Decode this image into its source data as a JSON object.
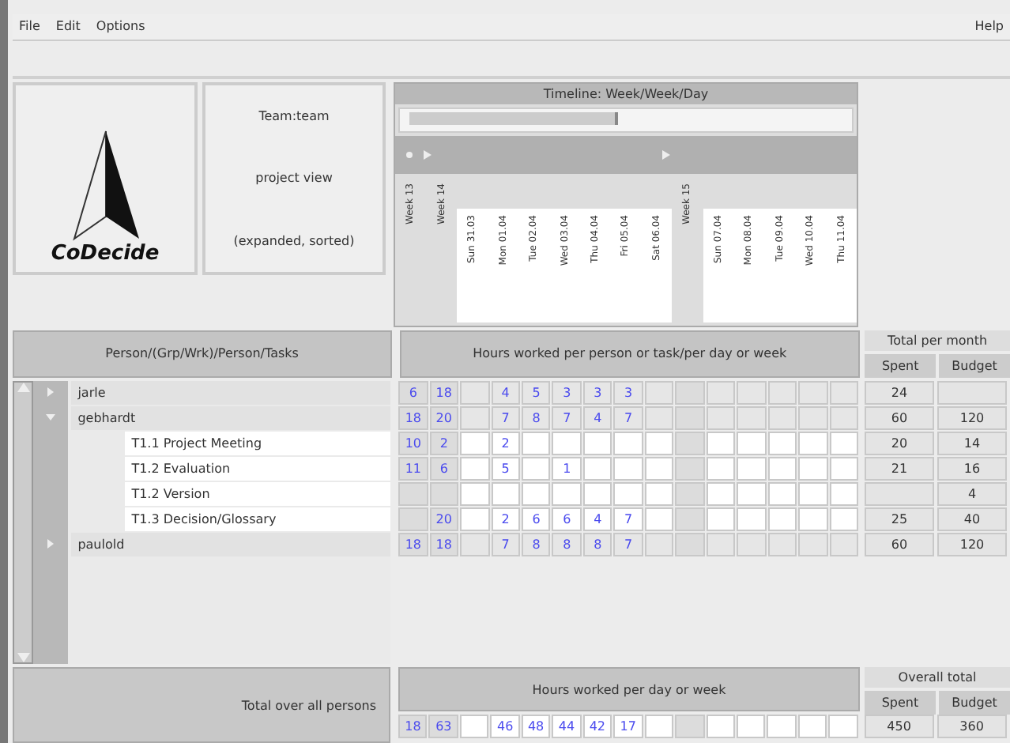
{
  "menu": [
    {
      "label": "File"
    },
    {
      "label": "Edit"
    },
    {
      "label": "Options"
    }
  ],
  "help": "Help",
  "logo": {
    "text": "CoDecide"
  },
  "team_panel": {
    "lines": [
      "Team:team",
      "project view",
      "(expanded, sorted)"
    ]
  },
  "timeline": {
    "title": "Timeline: Week/Week/Day",
    "columns": [
      {
        "label": "Week 13",
        "kind": "week"
      },
      {
        "label": "Week 14",
        "kind": "week"
      },
      {
        "label": "Sun 31.03",
        "kind": "day"
      },
      {
        "label": "Mon 01.04",
        "kind": "day"
      },
      {
        "label": "Tue 02.04",
        "kind": "day"
      },
      {
        "label": "Wed 03.04",
        "kind": "day"
      },
      {
        "label": "Thu 04.04",
        "kind": "day"
      },
      {
        "label": "Fri 05.04",
        "kind": "day"
      },
      {
        "label": "Sat 06.04",
        "kind": "day"
      },
      {
        "label": "Week 15",
        "kind": "week"
      },
      {
        "label": "Sun 07.04",
        "kind": "day"
      },
      {
        "label": "Mon 08.04",
        "kind": "day"
      },
      {
        "label": "Tue 09.04",
        "kind": "day"
      },
      {
        "label": "Wed 10.04",
        "kind": "day"
      },
      {
        "label": "Thu 11.04",
        "kind": "day"
      }
    ]
  },
  "tree_header": "Person/(Grp/Wrk)/Person/Tasks",
  "hours_header": "Hours worked per person or task/per day or week",
  "month_totals": {
    "title": "Total per month",
    "spent": "Spent",
    "budget": "Budget"
  },
  "rows": [
    {
      "name": "jarle",
      "kind": "person",
      "expanded": false,
      "cells": [
        "6",
        "18",
        null,
        "4",
        "5",
        "3",
        "3",
        "3",
        null,
        null,
        null,
        null,
        null,
        null,
        null
      ],
      "spent": "24"
    },
    {
      "name": "gebhardt",
      "kind": "person",
      "expanded": true,
      "cells": [
        "18",
        "20",
        null,
        "7",
        "8",
        "7",
        "4",
        "7",
        null,
        null,
        null,
        null,
        null,
        null,
        null
      ],
      "spent": "60",
      "budget": "120",
      "children": [
        {
          "name": "T1.1 Project Meeting",
          "kind": "task",
          "cells": [
            "10",
            "2",
            null,
            "2",
            null,
            null,
            null,
            null,
            null,
            null,
            null,
            null,
            null,
            null,
            null
          ],
          "spent": "20",
          "budget": "14"
        },
        {
          "name": "T1.2 Evaluation",
          "kind": "task",
          "cells": [
            "11",
            "6",
            null,
            "5",
            null,
            "1",
            null,
            null,
            null,
            null,
            null,
            null,
            null,
            null,
            null
          ],
          "spent": "21",
          "budget": "16"
        },
        {
          "name": "T1.2 Version",
          "kind": "task",
          "cells": [
            null,
            null,
            null,
            null,
            null,
            null,
            null,
            null,
            null,
            null,
            null,
            null,
            null,
            null,
            null
          ],
          "budget": "4"
        },
        {
          "name": "T1.3 Decision/Glossary",
          "kind": "task",
          "cells": [
            null,
            "20",
            null,
            "2",
            "6",
            "6",
            "4",
            "7",
            null,
            null,
            null,
            null,
            null,
            null,
            null
          ],
          "spent": "25",
          "budget": "40"
        }
      ]
    },
    {
      "name": "paulold",
      "kind": "person",
      "expanded": false,
      "cells": [
        "18",
        "18",
        null,
        "7",
        "8",
        "8",
        "8",
        "7",
        null,
        null,
        null,
        null,
        null,
        null,
        null
      ],
      "spent": "60",
      "budget": "120"
    }
  ],
  "footer": {
    "label": "Total over all persons",
    "hours_header": "Hours worked per day or week",
    "overall": {
      "title": "Overall total",
      "spent": "Spent",
      "budget": "Budget"
    },
    "cells": [
      "18",
      "63",
      null,
      "46",
      "48",
      "44",
      "42",
      "17",
      null,
      null,
      null,
      null,
      null,
      null,
      null
    ],
    "spent": "450",
    "budget": "360"
  }
}
